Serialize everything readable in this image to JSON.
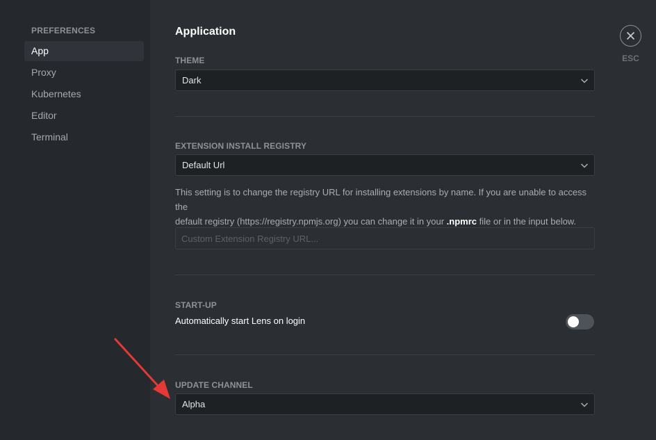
{
  "sidebar": {
    "heading": "PREFERENCES",
    "items": [
      {
        "label": "App"
      },
      {
        "label": "Proxy"
      },
      {
        "label": "Kubernetes"
      },
      {
        "label": "Editor"
      },
      {
        "label": "Terminal"
      }
    ],
    "active_item": "App"
  },
  "main": {
    "title": "Application",
    "theme": {
      "label": "THEME",
      "value": "Dark"
    },
    "registry": {
      "label": "EXTENSION INSTALL REGISTRY",
      "value": "Default Url",
      "help_line1": "This setting is to change the registry URL for installing extensions by name. If you are unable to access the",
      "help_line2_before": "default registry (https://registry.npmjs.org) you can change it in your ",
      "help_bold": ".npmrc",
      "help_line2_after": " file or in the input below.",
      "input_value": "",
      "input_placeholder": "Custom Extension Registry URL..."
    },
    "startup": {
      "label": "START-UP",
      "text": "Automatically start Lens on login",
      "enabled": false
    },
    "update_channel": {
      "label": "UPDATE CHANNEL",
      "value": "Alpha"
    }
  },
  "close": {
    "label": "ESC",
    "icon": "close-icon"
  },
  "colors": {
    "sidebar_bg": "#25282c",
    "main_bg": "#2b2e33",
    "select_bg": "#1e2124",
    "annotation_arrow": "#e53935"
  }
}
